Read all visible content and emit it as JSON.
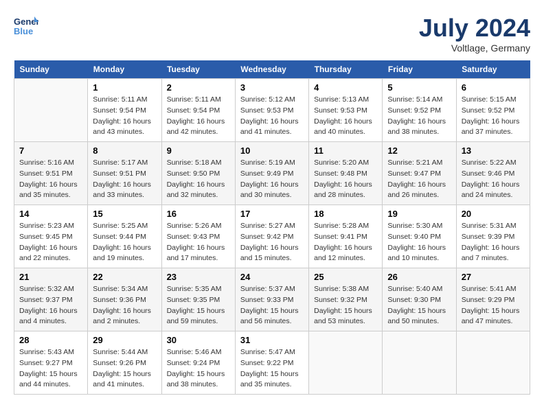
{
  "header": {
    "logo_line1": "General",
    "logo_line2": "Blue",
    "month": "July 2024",
    "location": "Voltlage, Germany"
  },
  "weekdays": [
    "Sunday",
    "Monday",
    "Tuesday",
    "Wednesday",
    "Thursday",
    "Friday",
    "Saturday"
  ],
  "weeks": [
    [
      {
        "day": "",
        "sunrise": "",
        "sunset": "",
        "daylight": ""
      },
      {
        "day": "1",
        "sunrise": "Sunrise: 5:11 AM",
        "sunset": "Sunset: 9:54 PM",
        "daylight": "Daylight: 16 hours and 43 minutes."
      },
      {
        "day": "2",
        "sunrise": "Sunrise: 5:11 AM",
        "sunset": "Sunset: 9:54 PM",
        "daylight": "Daylight: 16 hours and 42 minutes."
      },
      {
        "day": "3",
        "sunrise": "Sunrise: 5:12 AM",
        "sunset": "Sunset: 9:53 PM",
        "daylight": "Daylight: 16 hours and 41 minutes."
      },
      {
        "day": "4",
        "sunrise": "Sunrise: 5:13 AM",
        "sunset": "Sunset: 9:53 PM",
        "daylight": "Daylight: 16 hours and 40 minutes."
      },
      {
        "day": "5",
        "sunrise": "Sunrise: 5:14 AM",
        "sunset": "Sunset: 9:52 PM",
        "daylight": "Daylight: 16 hours and 38 minutes."
      },
      {
        "day": "6",
        "sunrise": "Sunrise: 5:15 AM",
        "sunset": "Sunset: 9:52 PM",
        "daylight": "Daylight: 16 hours and 37 minutes."
      }
    ],
    [
      {
        "day": "7",
        "sunrise": "Sunrise: 5:16 AM",
        "sunset": "Sunset: 9:51 PM",
        "daylight": "Daylight: 16 hours and 35 minutes."
      },
      {
        "day": "8",
        "sunrise": "Sunrise: 5:17 AM",
        "sunset": "Sunset: 9:51 PM",
        "daylight": "Daylight: 16 hours and 33 minutes."
      },
      {
        "day": "9",
        "sunrise": "Sunrise: 5:18 AM",
        "sunset": "Sunset: 9:50 PM",
        "daylight": "Daylight: 16 hours and 32 minutes."
      },
      {
        "day": "10",
        "sunrise": "Sunrise: 5:19 AM",
        "sunset": "Sunset: 9:49 PM",
        "daylight": "Daylight: 16 hours and 30 minutes."
      },
      {
        "day": "11",
        "sunrise": "Sunrise: 5:20 AM",
        "sunset": "Sunset: 9:48 PM",
        "daylight": "Daylight: 16 hours and 28 minutes."
      },
      {
        "day": "12",
        "sunrise": "Sunrise: 5:21 AM",
        "sunset": "Sunset: 9:47 PM",
        "daylight": "Daylight: 16 hours and 26 minutes."
      },
      {
        "day": "13",
        "sunrise": "Sunrise: 5:22 AM",
        "sunset": "Sunset: 9:46 PM",
        "daylight": "Daylight: 16 hours and 24 minutes."
      }
    ],
    [
      {
        "day": "14",
        "sunrise": "Sunrise: 5:23 AM",
        "sunset": "Sunset: 9:45 PM",
        "daylight": "Daylight: 16 hours and 22 minutes."
      },
      {
        "day": "15",
        "sunrise": "Sunrise: 5:25 AM",
        "sunset": "Sunset: 9:44 PM",
        "daylight": "Daylight: 16 hours and 19 minutes."
      },
      {
        "day": "16",
        "sunrise": "Sunrise: 5:26 AM",
        "sunset": "Sunset: 9:43 PM",
        "daylight": "Daylight: 16 hours and 17 minutes."
      },
      {
        "day": "17",
        "sunrise": "Sunrise: 5:27 AM",
        "sunset": "Sunset: 9:42 PM",
        "daylight": "Daylight: 16 hours and 15 minutes."
      },
      {
        "day": "18",
        "sunrise": "Sunrise: 5:28 AM",
        "sunset": "Sunset: 9:41 PM",
        "daylight": "Daylight: 16 hours and 12 minutes."
      },
      {
        "day": "19",
        "sunrise": "Sunrise: 5:30 AM",
        "sunset": "Sunset: 9:40 PM",
        "daylight": "Daylight: 16 hours and 10 minutes."
      },
      {
        "day": "20",
        "sunrise": "Sunrise: 5:31 AM",
        "sunset": "Sunset: 9:39 PM",
        "daylight": "Daylight: 16 hours and 7 minutes."
      }
    ],
    [
      {
        "day": "21",
        "sunrise": "Sunrise: 5:32 AM",
        "sunset": "Sunset: 9:37 PM",
        "daylight": "Daylight: 16 hours and 4 minutes."
      },
      {
        "day": "22",
        "sunrise": "Sunrise: 5:34 AM",
        "sunset": "Sunset: 9:36 PM",
        "daylight": "Daylight: 16 hours and 2 minutes."
      },
      {
        "day": "23",
        "sunrise": "Sunrise: 5:35 AM",
        "sunset": "Sunset: 9:35 PM",
        "daylight": "Daylight: 15 hours and 59 minutes."
      },
      {
        "day": "24",
        "sunrise": "Sunrise: 5:37 AM",
        "sunset": "Sunset: 9:33 PM",
        "daylight": "Daylight: 15 hours and 56 minutes."
      },
      {
        "day": "25",
        "sunrise": "Sunrise: 5:38 AM",
        "sunset": "Sunset: 9:32 PM",
        "daylight": "Daylight: 15 hours and 53 minutes."
      },
      {
        "day": "26",
        "sunrise": "Sunrise: 5:40 AM",
        "sunset": "Sunset: 9:30 PM",
        "daylight": "Daylight: 15 hours and 50 minutes."
      },
      {
        "day": "27",
        "sunrise": "Sunrise: 5:41 AM",
        "sunset": "Sunset: 9:29 PM",
        "daylight": "Daylight: 15 hours and 47 minutes."
      }
    ],
    [
      {
        "day": "28",
        "sunrise": "Sunrise: 5:43 AM",
        "sunset": "Sunset: 9:27 PM",
        "daylight": "Daylight: 15 hours and 44 minutes."
      },
      {
        "day": "29",
        "sunrise": "Sunrise: 5:44 AM",
        "sunset": "Sunset: 9:26 PM",
        "daylight": "Daylight: 15 hours and 41 minutes."
      },
      {
        "day": "30",
        "sunrise": "Sunrise: 5:46 AM",
        "sunset": "Sunset: 9:24 PM",
        "daylight": "Daylight: 15 hours and 38 minutes."
      },
      {
        "day": "31",
        "sunrise": "Sunrise: 5:47 AM",
        "sunset": "Sunset: 9:22 PM",
        "daylight": "Daylight: 15 hours and 35 minutes."
      },
      {
        "day": "",
        "sunrise": "",
        "sunset": "",
        "daylight": ""
      },
      {
        "day": "",
        "sunrise": "",
        "sunset": "",
        "daylight": ""
      },
      {
        "day": "",
        "sunrise": "",
        "sunset": "",
        "daylight": ""
      }
    ]
  ]
}
